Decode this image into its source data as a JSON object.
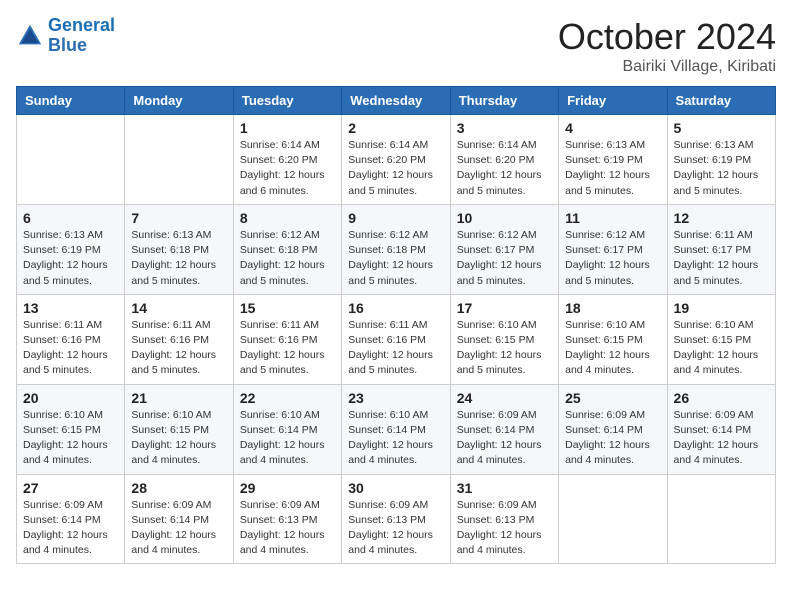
{
  "logo": {
    "line1": "General",
    "line2": "Blue"
  },
  "title": "October 2024",
  "location": "Bairiki Village, Kiribati",
  "headers": [
    "Sunday",
    "Monday",
    "Tuesday",
    "Wednesday",
    "Thursday",
    "Friday",
    "Saturday"
  ],
  "weeks": [
    [
      {
        "day": "",
        "info": ""
      },
      {
        "day": "",
        "info": ""
      },
      {
        "day": "1",
        "info": "Sunrise: 6:14 AM\nSunset: 6:20 PM\nDaylight: 12 hours and 6 minutes."
      },
      {
        "day": "2",
        "info": "Sunrise: 6:14 AM\nSunset: 6:20 PM\nDaylight: 12 hours and 5 minutes."
      },
      {
        "day": "3",
        "info": "Sunrise: 6:14 AM\nSunset: 6:20 PM\nDaylight: 12 hours and 5 minutes."
      },
      {
        "day": "4",
        "info": "Sunrise: 6:13 AM\nSunset: 6:19 PM\nDaylight: 12 hours and 5 minutes."
      },
      {
        "day": "5",
        "info": "Sunrise: 6:13 AM\nSunset: 6:19 PM\nDaylight: 12 hours and 5 minutes."
      }
    ],
    [
      {
        "day": "6",
        "info": "Sunrise: 6:13 AM\nSunset: 6:19 PM\nDaylight: 12 hours and 5 minutes."
      },
      {
        "day": "7",
        "info": "Sunrise: 6:13 AM\nSunset: 6:18 PM\nDaylight: 12 hours and 5 minutes."
      },
      {
        "day": "8",
        "info": "Sunrise: 6:12 AM\nSunset: 6:18 PM\nDaylight: 12 hours and 5 minutes."
      },
      {
        "day": "9",
        "info": "Sunrise: 6:12 AM\nSunset: 6:18 PM\nDaylight: 12 hours and 5 minutes."
      },
      {
        "day": "10",
        "info": "Sunrise: 6:12 AM\nSunset: 6:17 PM\nDaylight: 12 hours and 5 minutes."
      },
      {
        "day": "11",
        "info": "Sunrise: 6:12 AM\nSunset: 6:17 PM\nDaylight: 12 hours and 5 minutes."
      },
      {
        "day": "12",
        "info": "Sunrise: 6:11 AM\nSunset: 6:17 PM\nDaylight: 12 hours and 5 minutes."
      }
    ],
    [
      {
        "day": "13",
        "info": "Sunrise: 6:11 AM\nSunset: 6:16 PM\nDaylight: 12 hours and 5 minutes."
      },
      {
        "day": "14",
        "info": "Sunrise: 6:11 AM\nSunset: 6:16 PM\nDaylight: 12 hours and 5 minutes."
      },
      {
        "day": "15",
        "info": "Sunrise: 6:11 AM\nSunset: 6:16 PM\nDaylight: 12 hours and 5 minutes."
      },
      {
        "day": "16",
        "info": "Sunrise: 6:11 AM\nSunset: 6:16 PM\nDaylight: 12 hours and 5 minutes."
      },
      {
        "day": "17",
        "info": "Sunrise: 6:10 AM\nSunset: 6:15 PM\nDaylight: 12 hours and 5 minutes."
      },
      {
        "day": "18",
        "info": "Sunrise: 6:10 AM\nSunset: 6:15 PM\nDaylight: 12 hours and 4 minutes."
      },
      {
        "day": "19",
        "info": "Sunrise: 6:10 AM\nSunset: 6:15 PM\nDaylight: 12 hours and 4 minutes."
      }
    ],
    [
      {
        "day": "20",
        "info": "Sunrise: 6:10 AM\nSunset: 6:15 PM\nDaylight: 12 hours and 4 minutes."
      },
      {
        "day": "21",
        "info": "Sunrise: 6:10 AM\nSunset: 6:15 PM\nDaylight: 12 hours and 4 minutes."
      },
      {
        "day": "22",
        "info": "Sunrise: 6:10 AM\nSunset: 6:14 PM\nDaylight: 12 hours and 4 minutes."
      },
      {
        "day": "23",
        "info": "Sunrise: 6:10 AM\nSunset: 6:14 PM\nDaylight: 12 hours and 4 minutes."
      },
      {
        "day": "24",
        "info": "Sunrise: 6:09 AM\nSunset: 6:14 PM\nDaylight: 12 hours and 4 minutes."
      },
      {
        "day": "25",
        "info": "Sunrise: 6:09 AM\nSunset: 6:14 PM\nDaylight: 12 hours and 4 minutes."
      },
      {
        "day": "26",
        "info": "Sunrise: 6:09 AM\nSunset: 6:14 PM\nDaylight: 12 hours and 4 minutes."
      }
    ],
    [
      {
        "day": "27",
        "info": "Sunrise: 6:09 AM\nSunset: 6:14 PM\nDaylight: 12 hours and 4 minutes."
      },
      {
        "day": "28",
        "info": "Sunrise: 6:09 AM\nSunset: 6:14 PM\nDaylight: 12 hours and 4 minutes."
      },
      {
        "day": "29",
        "info": "Sunrise: 6:09 AM\nSunset: 6:13 PM\nDaylight: 12 hours and 4 minutes."
      },
      {
        "day": "30",
        "info": "Sunrise: 6:09 AM\nSunset: 6:13 PM\nDaylight: 12 hours and 4 minutes."
      },
      {
        "day": "31",
        "info": "Sunrise: 6:09 AM\nSunset: 6:13 PM\nDaylight: 12 hours and 4 minutes."
      },
      {
        "day": "",
        "info": ""
      },
      {
        "day": "",
        "info": ""
      }
    ]
  ]
}
